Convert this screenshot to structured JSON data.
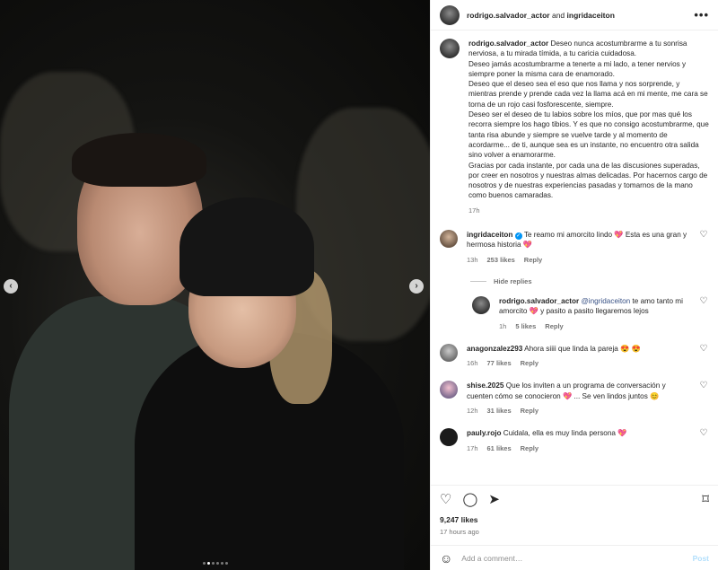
{
  "header": {
    "user1": "rodrigo.salvador_actor",
    "joiner": "and",
    "user2": "ingridaceiton",
    "more_label": "•••"
  },
  "caption": {
    "username": "rodrigo.salvador_actor",
    "text": " Deseo nunca acostumbrarme a tu sonrisa nerviosa, a tu mirada tímida, a tu caricia cuidadosa.\nDeseo jamás acostumbrarme a tenerte a mi lado, a tener nervios y siempre poner la misma cara de enamorado.\nDeseo que el deseo sea el eso que nos llama y nos sorprende, y mientras prende y prende cada vez la llama acá en mi mente, me cara se torna de un rojo casi fosforescente, siempre.\nDeseo ser el deseo de tu labios sobre los míos, que por mas qué los recorra siempre los hago tibios. Y es que no consigo acostumbrarme, que tanta risa abunde y siempre se vuelve tarde y al momento de acordarme... de ti, aunque sea es un instante, no encuentro otra salida sino volver a enamorarme.\nGracias por cada instante, por cada una de las discusiones superadas, por creer en nosotros y nuestras almas delicadas. Por hacernos cargo de nosotros y de nuestras experiencias pasadas y tomarnos de la mano como buenos camaradas.",
    "time": "17h"
  },
  "comments": [
    {
      "username": "ingridaceiton",
      "verified": "✓",
      "text": " Te reamo mi amorcito lindo 💖 Esta es una gran y hermosa historia 💖",
      "time": "13h",
      "likes": "253 likes",
      "reply": "Reply"
    },
    {
      "username": "anagonzalez293",
      "text": " Ahora siiii que linda la pareja 😍 😍",
      "time": "16h",
      "likes": "77 likes",
      "reply": "Reply"
    },
    {
      "username": "shise.2025",
      "text": " Que los inviten a un programa de conversación y cuenten cómo se conocieron 💖 ... Se ven lindos juntos 😊",
      "time": "12h",
      "likes": "31 likes",
      "reply": "Reply"
    },
    {
      "username": "pauly.rojo",
      "text": " Cuidala, ella es muy linda persona 💖",
      "time": "17h",
      "likes": "61 likes",
      "reply": "Reply"
    }
  ],
  "hide_replies": "Hide replies",
  "reply": {
    "username": "rodrigo.salvador_actor",
    "mention": "@ingridaceiton",
    "text": " te amo tanto mi amorcito 💖 y pasito a pasito llegaremos lejos",
    "time": "1h",
    "likes": "5 likes",
    "reply": "Reply"
  },
  "actions": {
    "like_icon": "♡",
    "comment_icon": "◯",
    "share_icon": "➤",
    "save_icon": "⌑"
  },
  "likes_count": "9,247 likes",
  "post_time": "17 hours ago",
  "add_comment": {
    "emoji_icon": "☺",
    "placeholder": "Add a comment…",
    "post_label": "Post"
  },
  "nav": {
    "prev": "‹",
    "next": "›"
  },
  "carousel": {
    "count": 6,
    "active": 1
  }
}
